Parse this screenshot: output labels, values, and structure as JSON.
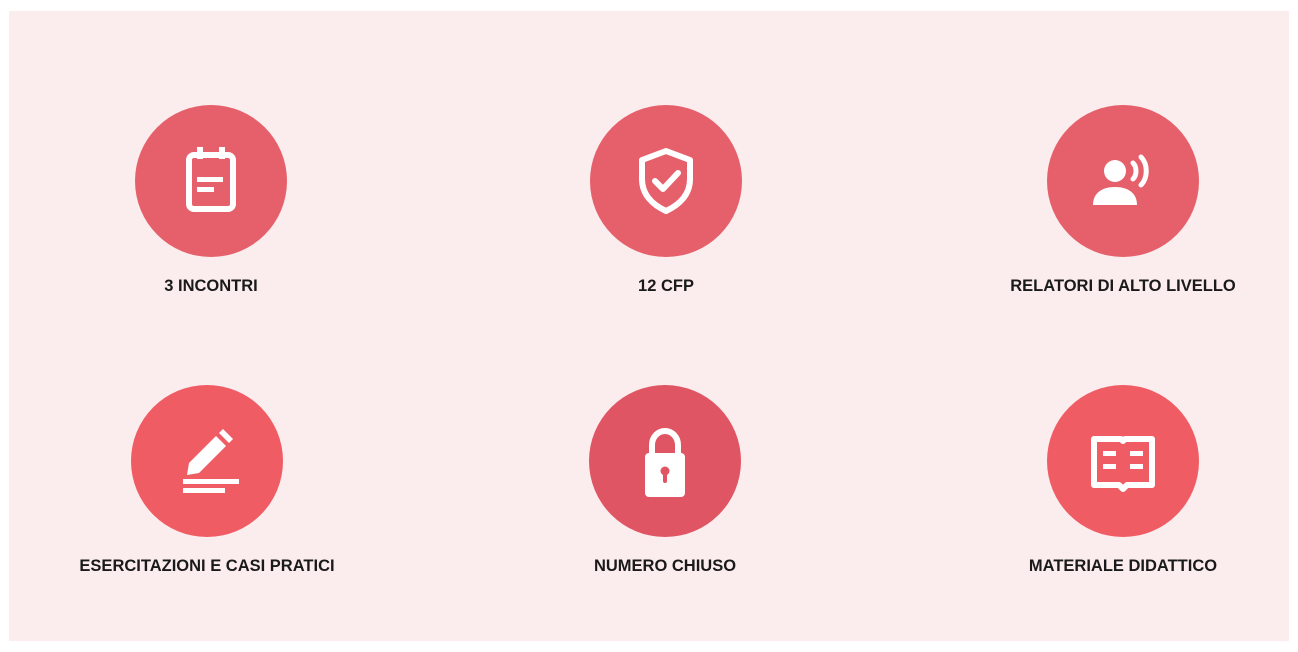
{
  "features": [
    {
      "label": "3 INCONTRI",
      "icon": "calendar-icon",
      "color": "#e5606a"
    },
    {
      "label": "12 CFP",
      "icon": "shield-check-icon",
      "color": "#e5606a"
    },
    {
      "label": "RELATORI DI ALTO LIVELLO",
      "icon": "speaker-icon",
      "color": "#e5606a"
    },
    {
      "label": "ESERCITAZIONI E CASI PRATICI",
      "icon": "pencil-edit-icon",
      "color": "#f05c64"
    },
    {
      "label": "NUMERO CHIUSO",
      "icon": "lock-icon",
      "color": "#e05563"
    },
    {
      "label": "MATERIALE DIDATTICO",
      "icon": "open-book-icon",
      "color": "#f05c64"
    }
  ]
}
